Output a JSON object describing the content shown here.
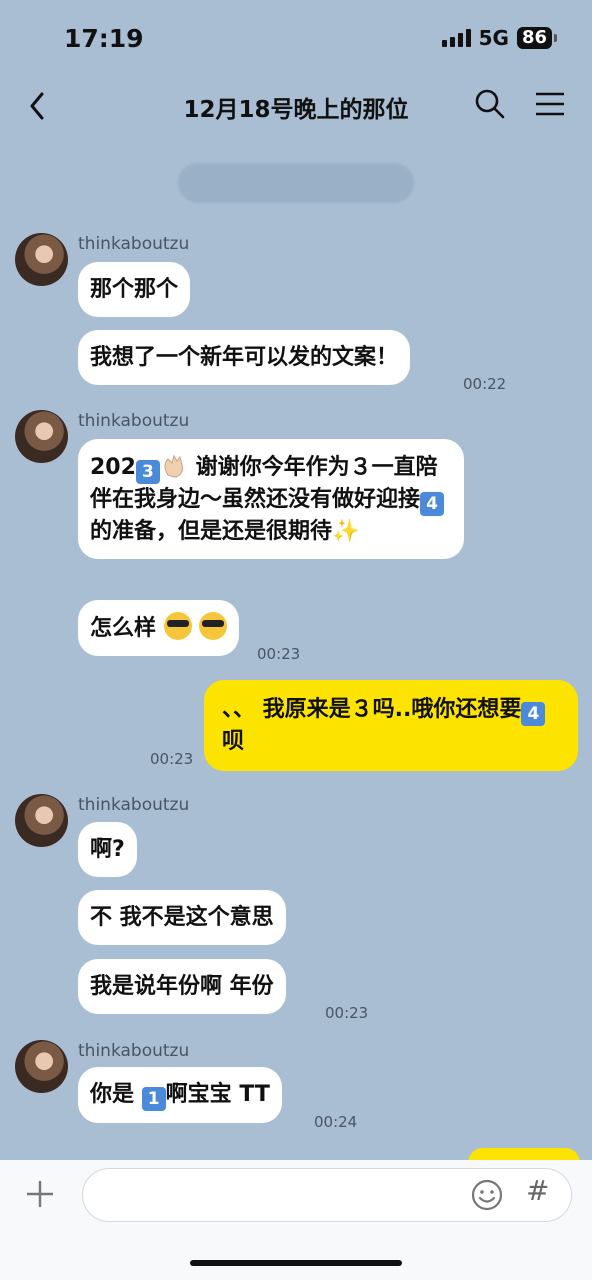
{
  "status_bar": {
    "time": "17:19",
    "network": "5G",
    "battery": "86"
  },
  "header": {
    "title": "12月18号晚上的那位"
  },
  "messages": {
    "g1": {
      "sender": "thinkaboutzu",
      "b1": "那个那个",
      "b2": "我想了一个新年可以发的文案！",
      "time": "00:22"
    },
    "g2": {
      "sender": "thinkaboutzu",
      "b1_part1": "202",
      "b1_emoji3": "3",
      "b1_part2": " 谢谢你今年作为３一直陪伴在我身边～虽然还没有做好迎接",
      "b1_emoji4": "4",
      "b1_part3": "的准备，但是还是很期待",
      "b1_sparkle": "✨",
      "b2": "怎么样",
      "time": "00:23"
    },
    "me1": {
      "prefix": "、、",
      "text": " 我原来是３吗..哦你还想要",
      "emoji": "4",
      "suffix": "呗",
      "time": "00:23"
    },
    "g3": {
      "sender": "thinkaboutzu",
      "b1": "啊?",
      "b2": "不 我不是这个意思",
      "b3": "我是说年份啊 年份",
      "time": "00:23"
    },
    "g4": {
      "sender": "thinkaboutzu",
      "b1_part1": "你是 ",
      "b1_emoji": "1",
      "b1_part2": "啊宝宝 TT",
      "time": "00:24"
    }
  },
  "composer": {
    "placeholder": "",
    "hash_label": "#"
  },
  "icons": [
    "back-icon",
    "search-icon",
    "menu-icon",
    "plus-icon",
    "emoji-icon"
  ]
}
